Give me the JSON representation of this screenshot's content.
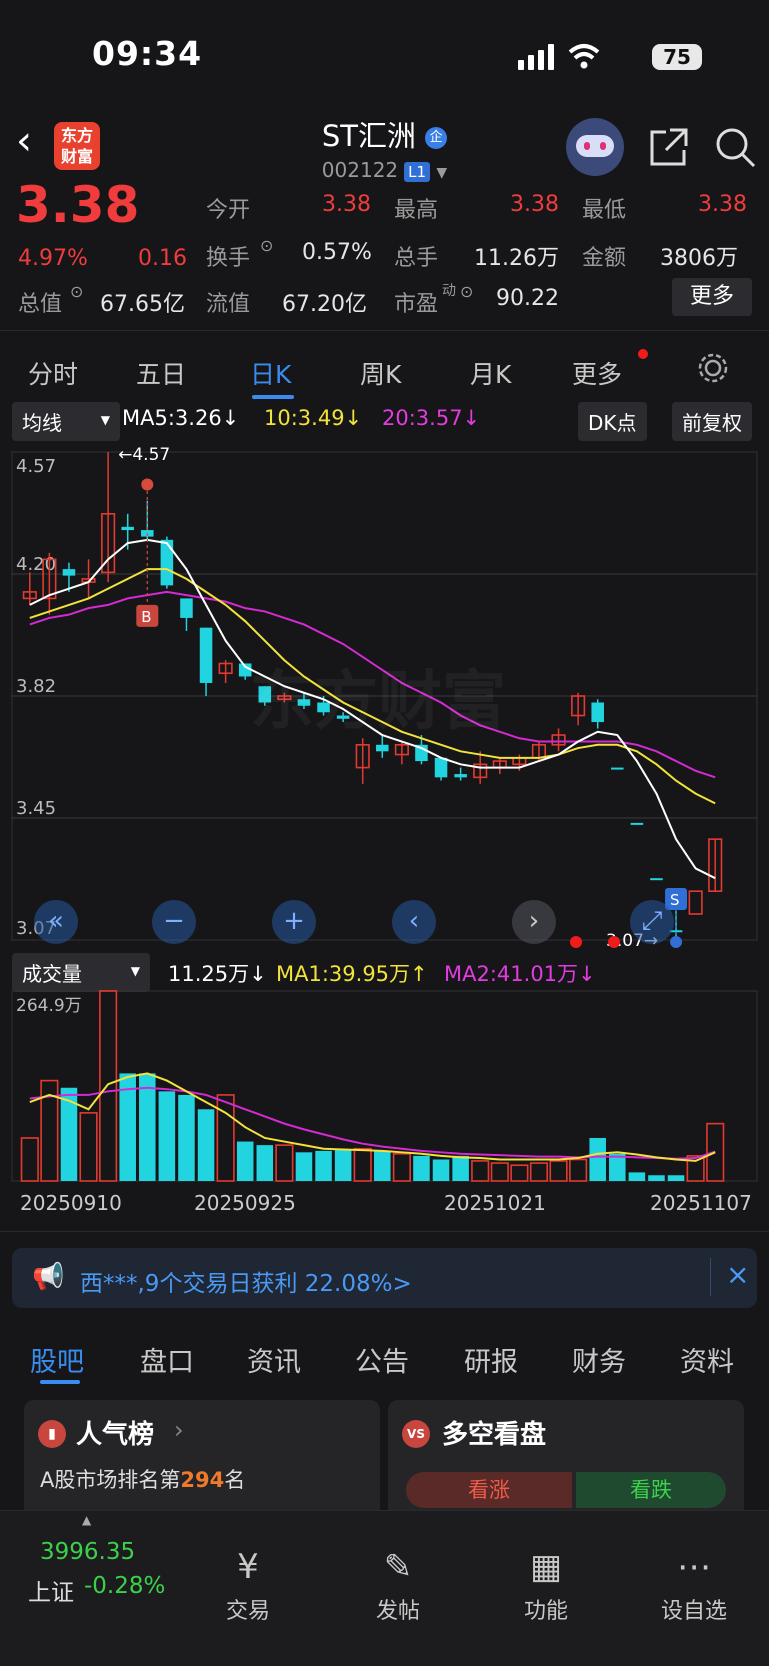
{
  "status": {
    "time": "09:34",
    "battery": "75"
  },
  "header": {
    "logo_line1": "东方",
    "logo_line2": "财富",
    "title": "ST汇洲",
    "badge": "企",
    "code": "002122",
    "level": "L1"
  },
  "quote": {
    "price": "3.38",
    "pct": "4.97%",
    "chg": "0.16",
    "open_label": "今开",
    "open": "3.38",
    "high_label": "最高",
    "high": "3.38",
    "low_label": "最低",
    "low": "3.38",
    "turnover_label": "换手",
    "turnover": "0.57%",
    "vol_label": "总手",
    "vol": "11.26万",
    "amount_label": "金额",
    "amount": "3806万",
    "mcap_label": "总值",
    "mcap": "67.65亿",
    "float_label": "流值",
    "float": "67.20亿",
    "pe_label": "市盈",
    "pe_sup": "动",
    "pe": "90.22",
    "more": "更多"
  },
  "kline_tabs": [
    "分时",
    "五日",
    "日K",
    "周K",
    "月K",
    "更多"
  ],
  "ma_bar": {
    "selector": "均线",
    "ma5": "MA5:3.26↓",
    "ma10": "10:3.49↓",
    "ma20": "20:3.57↓",
    "dk": "DK点",
    "fq": "前复权"
  },
  "price_axis": [
    "4.57",
    "4.20",
    "3.82",
    "3.45",
    "3.07"
  ],
  "annotations": {
    "high": "←4.57",
    "low": "3.07→",
    "buy": "B",
    "sell": "S"
  },
  "vol_bar": {
    "selector": "成交量",
    "vol": "11.25万↓",
    "ma1": "MA1:39.95万↑",
    "ma2": "MA2:41.01万↓",
    "axis_max": "264.9万"
  },
  "dates": [
    "20250910",
    "20250925",
    "20251021",
    "20251107"
  ],
  "banner": {
    "text": "西***,9个交易日获利 22.08%>",
    "close": "×"
  },
  "section_tabs": [
    "股吧",
    "盘口",
    "资讯",
    "公告",
    "研报",
    "财务",
    "资料"
  ],
  "cards": {
    "hot_title": "人气榜",
    "hot_rank_prefix": "A股市场排名第",
    "hot_rank": "294",
    "hot_rank_suffix": "名",
    "vs_title": "多空看盘",
    "vs_badge": "VS",
    "bull": "看涨",
    "bear": "看跌"
  },
  "bottom": {
    "index_value": "3996.35",
    "index_name": "上证",
    "index_pct": "-0.28%",
    "items": [
      "交易",
      "发帖",
      "功能",
      "设自选"
    ]
  },
  "chart_data": {
    "type": "candlestick",
    "ylim": [
      3.07,
      4.57
    ],
    "candles": [
      {
        "o": 4.14,
        "h": 4.2,
        "l": 4.1,
        "c": 4.12,
        "dir": "up"
      },
      {
        "o": 4.12,
        "h": 4.26,
        "l": 4.07,
        "c": 4.24,
        "dir": "up"
      },
      {
        "o": 4.19,
        "h": 4.23,
        "l": 4.14,
        "c": 4.21,
        "dir": "down"
      },
      {
        "o": 4.17,
        "h": 4.24,
        "l": 4.12,
        "c": 4.18,
        "dir": "up"
      },
      {
        "o": 4.2,
        "h": 4.57,
        "l": 4.17,
        "c": 4.38,
        "dir": "up"
      },
      {
        "o": 4.34,
        "h": 4.38,
        "l": 4.27,
        "c": 4.33,
        "dir": "down"
      },
      {
        "o": 4.33,
        "h": 4.42,
        "l": 4.3,
        "c": 4.31,
        "dir": "down"
      },
      {
        "o": 4.3,
        "h": 4.31,
        "l": 4.15,
        "c": 4.16,
        "dir": "down"
      },
      {
        "o": 4.12,
        "h": 4.12,
        "l": 4.02,
        "c": 4.06,
        "dir": "down"
      },
      {
        "o": 4.03,
        "h": 4.03,
        "l": 3.82,
        "c": 3.86,
        "dir": "down"
      },
      {
        "o": 3.89,
        "h": 3.93,
        "l": 3.86,
        "c": 3.92,
        "dir": "up"
      },
      {
        "o": 3.92,
        "h": 3.92,
        "l": 3.87,
        "c": 3.88,
        "dir": "down"
      },
      {
        "o": 3.85,
        "h": 3.85,
        "l": 3.79,
        "c": 3.8,
        "dir": "down"
      },
      {
        "o": 3.82,
        "h": 3.83,
        "l": 3.8,
        "c": 3.81,
        "dir": "up"
      },
      {
        "o": 3.81,
        "h": 3.83,
        "l": 3.78,
        "c": 3.79,
        "dir": "down"
      },
      {
        "o": 3.8,
        "h": 3.82,
        "l": 3.76,
        "c": 3.77,
        "dir": "down"
      },
      {
        "o": 3.76,
        "h": 3.77,
        "l": 3.74,
        "c": 3.75,
        "dir": "down"
      },
      {
        "o": 3.6,
        "h": 3.69,
        "l": 3.55,
        "c": 3.67,
        "dir": "up"
      },
      {
        "o": 3.67,
        "h": 3.7,
        "l": 3.63,
        "c": 3.65,
        "dir": "down"
      },
      {
        "o": 3.64,
        "h": 3.68,
        "l": 3.61,
        "c": 3.67,
        "dir": "up"
      },
      {
        "o": 3.67,
        "h": 3.7,
        "l": 3.61,
        "c": 3.62,
        "dir": "down"
      },
      {
        "o": 3.63,
        "h": 3.63,
        "l": 3.56,
        "c": 3.57,
        "dir": "down"
      },
      {
        "o": 3.58,
        "h": 3.6,
        "l": 3.56,
        "c": 3.57,
        "dir": "down"
      },
      {
        "o": 3.57,
        "h": 3.65,
        "l": 3.55,
        "c": 3.61,
        "dir": "up"
      },
      {
        "o": 3.6,
        "h": 3.63,
        "l": 3.58,
        "c": 3.62,
        "dir": "up"
      },
      {
        "o": 3.61,
        "h": 3.64,
        "l": 3.59,
        "c": 3.63,
        "dir": "up"
      },
      {
        "o": 3.63,
        "h": 3.68,
        "l": 3.62,
        "c": 3.67,
        "dir": "up"
      },
      {
        "o": 3.67,
        "h": 3.72,
        "l": 3.65,
        "c": 3.7,
        "dir": "up"
      },
      {
        "o": 3.76,
        "h": 3.83,
        "l": 3.73,
        "c": 3.82,
        "dir": "up"
      },
      {
        "o": 3.8,
        "h": 3.81,
        "l": 3.72,
        "c": 3.74,
        "dir": "down"
      },
      {
        "o": 3.6,
        "h": 3.6,
        "l": 3.6,
        "c": 3.6,
        "dir": "down"
      },
      {
        "o": 3.43,
        "h": 3.43,
        "l": 3.43,
        "c": 3.43,
        "dir": "down"
      },
      {
        "o": 3.26,
        "h": 3.26,
        "l": 3.26,
        "c": 3.26,
        "dir": "down"
      },
      {
        "o": 3.1,
        "h": 3.16,
        "l": 3.07,
        "c": 3.1,
        "dir": "down"
      },
      {
        "o": 3.15,
        "h": 3.15,
        "l": 3.15,
        "c": 3.22,
        "dir": "up"
      },
      {
        "o": 3.22,
        "h": 3.38,
        "l": 3.22,
        "c": 3.38,
        "dir": "up"
      }
    ],
    "ma5": [
      4.1,
      4.13,
      4.15,
      4.17,
      4.24,
      4.29,
      4.3,
      4.29,
      4.21,
      4.1,
      3.99,
      3.91,
      3.88,
      3.85,
      3.83,
      3.81,
      3.78,
      3.74,
      3.7,
      3.68,
      3.66,
      3.63,
      3.61,
      3.6,
      3.6,
      3.6,
      3.62,
      3.64,
      3.68,
      3.71,
      3.7,
      3.62,
      3.52,
      3.38,
      3.29,
      3.26
    ],
    "ma10": [
      4.06,
      4.08,
      4.1,
      4.12,
      4.15,
      4.18,
      4.21,
      4.21,
      4.18,
      4.14,
      4.1,
      4.05,
      3.99,
      3.93,
      3.88,
      3.84,
      3.8,
      3.77,
      3.74,
      3.71,
      3.69,
      3.67,
      3.65,
      3.64,
      3.63,
      3.63,
      3.63,
      3.64,
      3.66,
      3.67,
      3.67,
      3.65,
      3.61,
      3.56,
      3.52,
      3.49
    ],
    "ma20": [
      4.04,
      4.06,
      4.07,
      4.09,
      4.1,
      4.12,
      4.13,
      4.14,
      4.13,
      4.12,
      4.11,
      4.09,
      4.08,
      4.06,
      4.04,
      4.01,
      3.98,
      3.94,
      3.9,
      3.86,
      3.83,
      3.8,
      3.76,
      3.73,
      3.71,
      3.69,
      3.68,
      3.68,
      3.68,
      3.68,
      3.68,
      3.67,
      3.65,
      3.62,
      3.59,
      3.57
    ],
    "volume": [
      60,
      140,
      130,
      95,
      265,
      150,
      150,
      125,
      120,
      100,
      120,
      55,
      50,
      50,
      40,
      42,
      44,
      45,
      42,
      38,
      35,
      30,
      35,
      28,
      25,
      22,
      25,
      28,
      30,
      60,
      38,
      12,
      8,
      8,
      35,
      80
    ],
    "vol_ma1": [
      110,
      120,
      112,
      100,
      135,
      145,
      150,
      140,
      125,
      110,
      95,
      75,
      60,
      55,
      50,
      45,
      44,
      43,
      42,
      40,
      38,
      35,
      33,
      32,
      30,
      30,
      30,
      30,
      32,
      38,
      40,
      37,
      33,
      30,
      28,
      40
    ],
    "vol_ma2": [
      115,
      118,
      120,
      120,
      125,
      128,
      130,
      128,
      125,
      120,
      110,
      100,
      90,
      80,
      72,
      65,
      58,
      52,
      48,
      45,
      42,
      40,
      38,
      37,
      36,
      35,
      34,
      34,
      33,
      34,
      34,
      33,
      32,
      31,
      32,
      41
    ],
    "vol_ylim": [
      0,
      264.9
    ]
  }
}
